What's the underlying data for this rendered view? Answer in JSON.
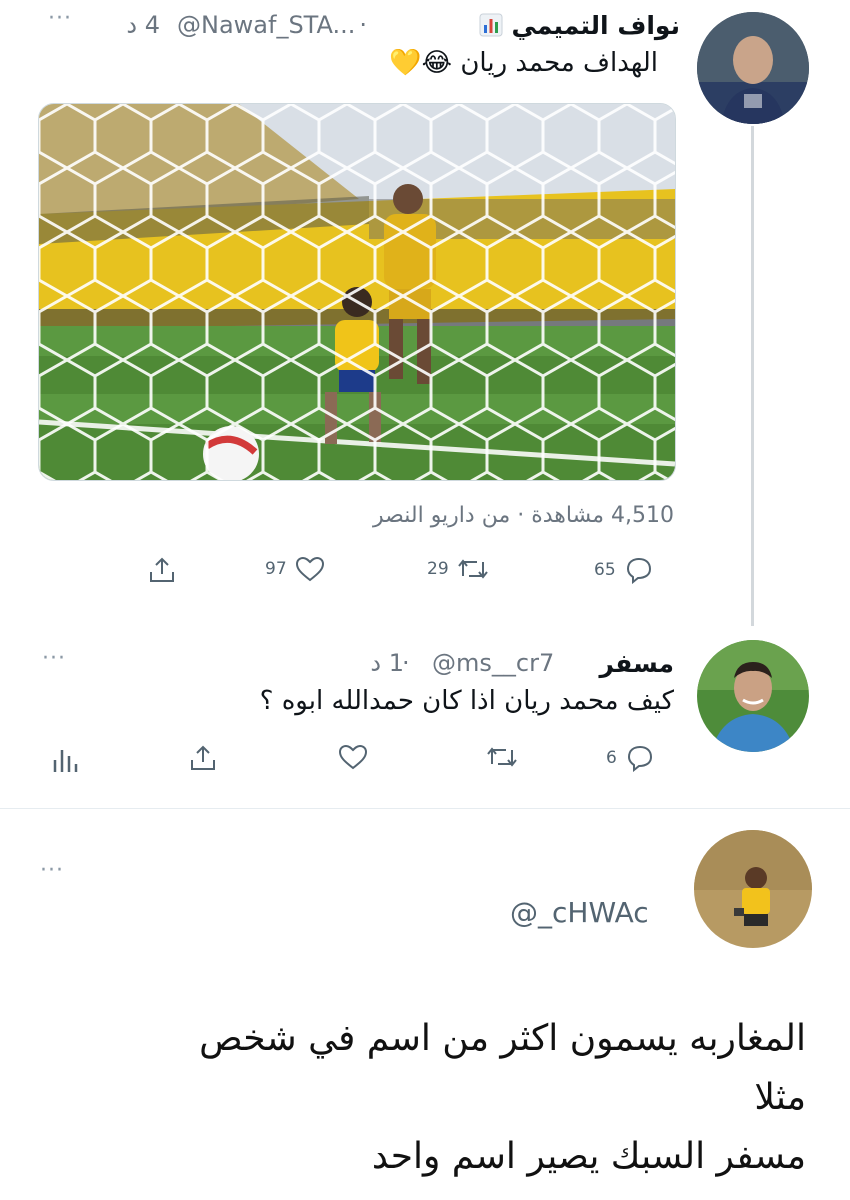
{
  "tweet1": {
    "author_name": "نواف التميمي",
    "author_emoji": "📊",
    "handle": "@Nawaf_STA...",
    "separator": "·",
    "time": "4 د",
    "text": "الهداف محمد ريان 😂💛",
    "views_line": "4,510 مشاهدة · من داريو النصر",
    "replies": "65",
    "retweets": "29",
    "likes": "97",
    "more": "···"
  },
  "tweet2": {
    "author_name": "مسفر",
    "handle": "@ms__cr7",
    "separator": "·",
    "time": "1 د",
    "text": "كيف محمد ريان اذا كان حمدالله ابوه ؟",
    "replies": "6",
    "more": "···"
  },
  "tweet3": {
    "handle": "@_cHWAc",
    "more": "···",
    "body_lines": [
      "المغاربه يسمون اكثر من اسم في شخص",
      "مثلا",
      "مسفر السبك يصير اسم واحد"
    ]
  },
  "icons": [
    "more-icon",
    "reply-icon",
    "retweet-icon",
    "like-icon",
    "share-icon",
    "analytics-icon",
    "chart-emoji-icon"
  ],
  "colors": {
    "stadium_yellow": "#e7c21f",
    "pitch_green": "#4f8a36",
    "sky": "#cfd8e2",
    "muted_text": "#6b7580",
    "thread_line": "#d3d8dc"
  }
}
